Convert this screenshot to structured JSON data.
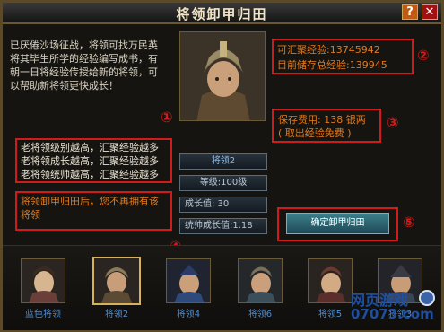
{
  "window": {
    "title": "将领卸甲归田",
    "help_label": "?",
    "close_label": "✕"
  },
  "intro_text": "已厌倦沙场征战，将领可找万民英将其毕生所学的经验编写成书，有朝一日将经验传授给新的将领，可以帮助新将领更快成长！",
  "exp": {
    "total_label": "可汇聚经验:",
    "total_value": "13745942",
    "stored_label": "目前储存总经验:",
    "stored_value": "139945"
  },
  "fee": {
    "label": "保存费用:",
    "value": "138",
    "unit": "银两",
    "note": "( 取出经验免费 )"
  },
  "rules": [
    "老将领级别越高，汇聚经验越多",
    "老将领成长越高，汇聚经验越多",
    "老将领统帅越高，汇聚经验越多"
  ],
  "warning": "将领卸甲归田后，您不再拥有该将领",
  "general": {
    "name": "将领2",
    "level": "等级:100级",
    "growth": "成长值:       30",
    "lead_growth": "统帅成长值:1.18"
  },
  "confirm_button": "确定卸甲归田",
  "generals": [
    "蓝色将领",
    "将领2",
    "将领4",
    "将领6",
    "将领5",
    "将领3"
  ],
  "markers": [
    "①",
    "②",
    "③",
    "④",
    "⑤"
  ],
  "watermark": {
    "main": "网页游戏",
    "url": "07073.com"
  },
  "colors": {
    "accent_red": "#d11a1a",
    "value_orange": "#e27a1d",
    "label_blue": "#4d8fd6"
  }
}
